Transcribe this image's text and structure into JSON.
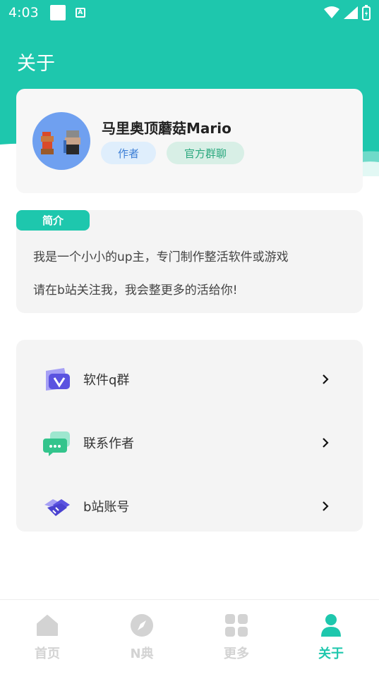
{
  "status_bar": {
    "time": "4:03"
  },
  "page": {
    "title": "关于"
  },
  "profile": {
    "name": "马里奥顶蘑菇Mario",
    "tags": [
      "作者",
      "官方群聊"
    ]
  },
  "intro": {
    "badge": "简介",
    "lines": [
      "我是一个小小的up主，专门制作整活软件或游戏",
      "请在b站关注我，我会整更多的活给你!"
    ]
  },
  "menu": {
    "items": [
      {
        "label": "软件q群",
        "icon": "v-badge-icon"
      },
      {
        "label": "联系作者",
        "icon": "chat-bubble-icon"
      },
      {
        "label": "b站账号",
        "icon": "handshake-icon"
      }
    ]
  },
  "bottom_nav": {
    "items": [
      {
        "label": "首页",
        "icon": "home-icon",
        "active": false
      },
      {
        "label": "N典",
        "icon": "compass-icon",
        "active": false
      },
      {
        "label": "更多",
        "icon": "grid-icon",
        "active": false
      },
      {
        "label": "关于",
        "icon": "person-icon",
        "active": true
      }
    ]
  },
  "colors": {
    "accent": "#1ec7ad",
    "inactive": "#d3d3d3",
    "card": "#f4f4f4"
  }
}
